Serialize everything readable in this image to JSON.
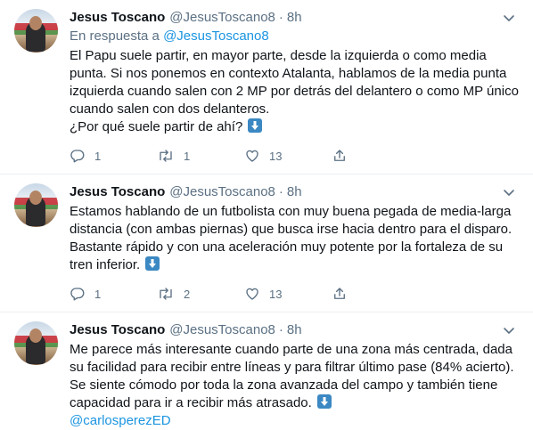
{
  "tweets": [
    {
      "name": "Jesus Toscano",
      "handle": "@JesusToscano8",
      "dot": "·",
      "time": "8h",
      "reply_prefix": "En respuesta a",
      "reply_handle": "@JesusToscano8",
      "text": "El Papu suele partir, en mayor parte, desde la izquierda o como media punta. Si nos ponemos en contexto Atalanta, hablamos de la media punta izquierda cuando salen con 2 MP por detrás del delantero o como MP único cuando salen con dos delanteros.\n¿Por qué suele partir de ahí?",
      "reply_count": "1",
      "retweet_count": "1",
      "like_count": "13"
    },
    {
      "name": "Jesus Toscano",
      "handle": "@JesusToscano8",
      "dot": "·",
      "time": "8h",
      "text": "Estamos hablando de un futbolista con muy buena pegada de media-larga distancia (con ambas piernas) que busca irse hacia dentro para el disparo. Bastante rápido y con una aceleración muy potente por la fortaleza de su tren inferior.",
      "reply_count": "1",
      "retweet_count": "2",
      "like_count": "13"
    },
    {
      "name": "Jesus Toscano",
      "handle": "@JesusToscano8",
      "dot": "·",
      "time": "8h",
      "text": "Me parece más interesante cuando parte de una zona más centrada, dada su facilidad para recibir entre líneas y para filtrar último pase (84% acierto). Se siente cómodo por toda la zona avanzada del campo y también tiene capacidad para ir a recibir más atrasado.",
      "mention": "@carlosperezED"
    }
  ],
  "icons": {
    "more": "chevron-down-icon",
    "reply": "reply-icon",
    "retweet": "retweet-icon",
    "like": "heart-icon",
    "share": "share-icon",
    "arrow": "down-arrow-emoji"
  },
  "colors": {
    "accent": "#1b95e0",
    "muted": "#5b7083",
    "text": "#0f1419",
    "divider": "#ebeef0",
    "emoji": "#3b88c3"
  }
}
